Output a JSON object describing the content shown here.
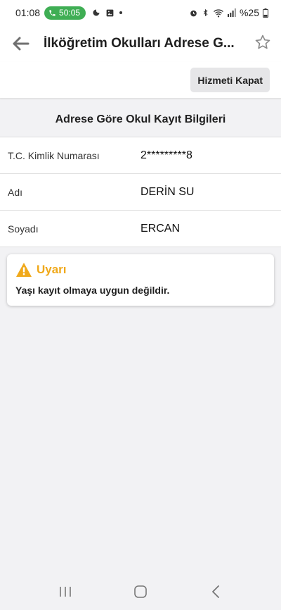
{
  "status_bar": {
    "time": "01:08",
    "call_duration": "50:05",
    "battery": "%25",
    "icons": [
      "phone-icon",
      "moon-icon",
      "image-icon",
      "alarm-icon",
      "bluetooth-icon",
      "wifi-icon",
      "signal-icon",
      "battery-icon"
    ]
  },
  "app_bar": {
    "title": "İlköğretim Okulları Adrese G...",
    "back_icon": "back-arrow-icon",
    "favorite_icon": "star-outline-icon"
  },
  "actions": {
    "close_service_label": "Hizmeti Kapat"
  },
  "info": {
    "title": "Adrese Göre Okul Kayıt Bilgileri",
    "rows": [
      {
        "label": "T.C. Kimlik Numarası",
        "value": "2*********8"
      },
      {
        "label": "Adı",
        "value": "DERİN SU"
      },
      {
        "label": "Soyadı",
        "value": "ERCAN"
      }
    ]
  },
  "warning": {
    "icon": "warning-triangle-icon",
    "title": "Uyarı",
    "message": "Yaşı kayıt olmaya uygun değildir.",
    "color": "#f0a91b"
  },
  "nav_bar": {
    "buttons": [
      "recent-apps-icon",
      "home-icon",
      "back-icon"
    ]
  }
}
